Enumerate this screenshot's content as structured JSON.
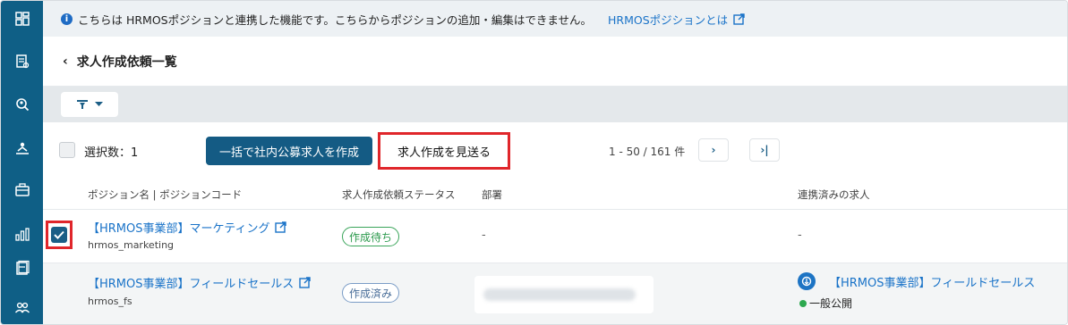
{
  "info_bar": {
    "message": "こちらは HRMOSポジションと連携した機能です。こちらからポジションの追加・編集はできません。",
    "link_label": "HRMOSポジションとは"
  },
  "header": {
    "back": "‹",
    "title": "求人作成依頼一覧"
  },
  "toolbar": {
    "selected_count": "選択数：1",
    "bulk_create_label": "一括で社内公募求人を作成",
    "skip_label": "求人作成を見送る",
    "pagination": "1 - 50 / 161 件",
    "next_label": "›",
    "last_label": "›|"
  },
  "table": {
    "columns": [
      "ポジション名 | ポジションコード",
      "求人作成依頼ステータス",
      "部署",
      "連携済みの求人"
    ],
    "rows": [
      {
        "position_name": "【HRMOS事業部】マーケティング",
        "position_code": "hrmos_marketing",
        "status": "作成待ち",
        "department": "-",
        "linked_job": "-",
        "selected": true
      },
      {
        "position_name": "【HRMOS事業部】フィールドセールス",
        "position_code": "hrmos_fs",
        "status": "作成済み",
        "department": "",
        "linked_job": "【HRMOS事業部】フィールドセールス",
        "linked_status": "一般公開",
        "selected": false
      }
    ]
  },
  "colors": {
    "sidebar": "#0f5f86",
    "primary_button": "#145b84",
    "link": "#1a73c8",
    "highlight": "#e0262b",
    "waiting_green": "#2c9a4d",
    "done_blue": "#4a6e99"
  },
  "sidebar_icons": [
    "dashboard-icon",
    "job-list-icon",
    "search-candidate-icon",
    "recruit-icon",
    "briefcase-icon",
    "analytics-icon",
    "documents-icon",
    "users-icon"
  ]
}
